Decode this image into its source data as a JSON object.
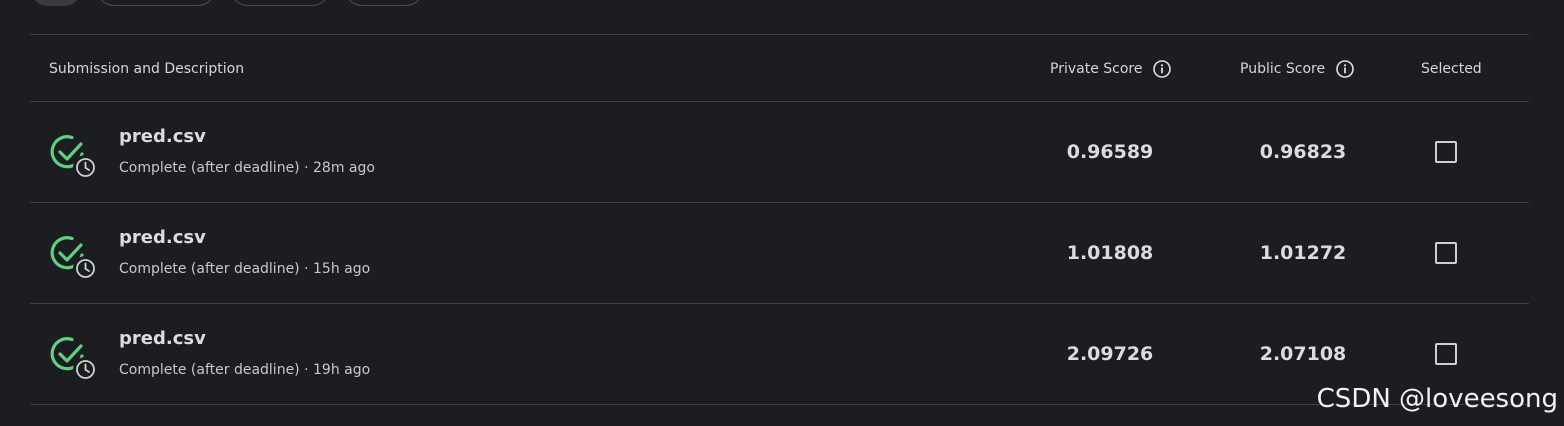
{
  "table": {
    "headers": {
      "description": "Submission and Description",
      "private_score": "Private Score",
      "public_score": "Public Score",
      "selected": "Selected"
    },
    "rows": [
      {
        "file_name": "pred.csv",
        "status": "Complete (after deadline)",
        "separator": " · ",
        "time_ago": "28m ago",
        "private_score": "0.96589",
        "public_score": "0.96823",
        "selected": false
      },
      {
        "file_name": "pred.csv",
        "status": "Complete (after deadline)",
        "separator": " · ",
        "time_ago": "15h ago",
        "private_score": "1.01808",
        "public_score": "1.01272",
        "selected": false
      },
      {
        "file_name": "pred.csv",
        "status": "Complete (after deadline)",
        "separator": " · ",
        "time_ago": "19h ago",
        "private_score": "2.09726",
        "public_score": "2.07108",
        "selected": false
      }
    ]
  },
  "icons": {
    "status": "check-circle-with-clock-icon",
    "info": "info-icon"
  },
  "colors": {
    "background": "#1c1d20",
    "success_green": "#5fcf80",
    "divider": "#3d3e43"
  },
  "watermark": "CSDN @loveesong"
}
